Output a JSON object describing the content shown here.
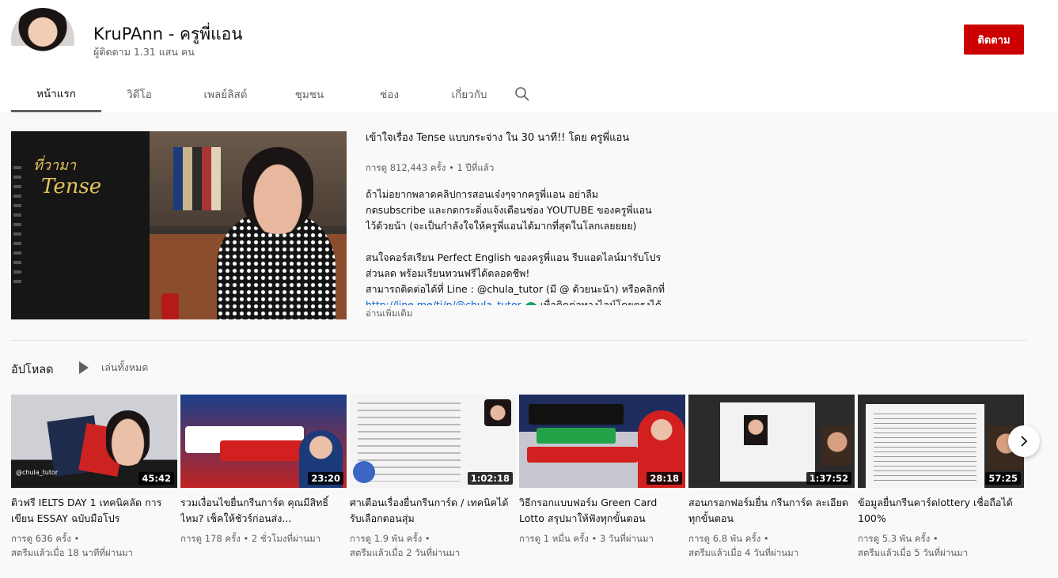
{
  "channel": {
    "title": "KruPAnn - ครูพี่แอน",
    "subscribers": "ผู้ติดตาม 1.31 แสน คน",
    "subscribe_label": "ติดตาม"
  },
  "tabs": [
    {
      "label": "หน้าแรก",
      "active": true
    },
    {
      "label": "วิดีโอ"
    },
    {
      "label": "เพลย์ลิสต์"
    },
    {
      "label": "ชุมชน"
    },
    {
      "label": "ช่อง"
    },
    {
      "label": "เกี่ยวกับ"
    }
  ],
  "featured": {
    "title": "เข้าใจเรื่อง Tense แบบกระจ่าง ใน 30 นาที!! โดย ครูพี่แอน",
    "meta": "การดู 812,443 ครั้ง • 1 ปีที่แล้ว",
    "board_text_1": "ที่วามา",
    "board_text_2": "Tense",
    "description": [
      "ถ้าไม่อยากพลาดคลิปการสอนเจ๋งๆจากครูพี่แอน อย่าลืม",
      "กดsubscribe และกดกระดิ่งแจ้งเตือนช่อง YOUTUBE ของครูพี่แอน",
      "ไว้ด้วยน้า (จะเป็นกำลังใจให้ครูพี่แอนได้มากที่สุดในโลกเลยยยย)",
      "",
      "สนใจคอร์สเรียน Perfect English ของครูพี่แอน รีบแอดไลน์มารับโปร",
      "ส่วนลด พร้อมเรียนทวนฟรีได้ตลอดชีพ!",
      "สามารถติดต่อได้ที่ Line : @chula_tutor (มี @ ด้วยนะน้า)  หรือคลิกที่"
    ],
    "link": "http://line.me/ti/p/@chula_tutor",
    "link_suffix": "เพื่อติดต่อทางไลน์โดยตรงได้",
    "read_more": "อ่านเพิ่มเติม"
  },
  "uploads": {
    "title": "อัปโหลด",
    "play_all": "เล่นทั้งหมด",
    "videos": [
      {
        "title": "ติวฟรี IELTS DAY 1 เทคนิคลัด การเขียน ESSAY ฉบับมือโปร",
        "duration": "45:42",
        "views": "การดู 636 ครั้ง •",
        "time": "สตรีมแล้วเมื่อ 18 นาทีที่ผ่านมา",
        "thumb_caption": "@chula_tutor"
      },
      {
        "title": "รวมเงื่อนไขยื่นกรีนการ์ด คุณมีสิทธิ์ไหม? เช็คให้ชัวร์ก่อนส่ง...",
        "duration": "23:20",
        "views": "การดู 178 ครั้ง • 2 ชั่วโมงที่ผ่านมา",
        "time": ""
      },
      {
        "title": "ศาเตือนเรื่องยื่นกรีนการ์ด / เทคนิคได้รับเลือกตอนสุ่ม",
        "duration": "1:02:18",
        "views": "การดู 1.9 พัน ครั้ง •",
        "time": "สตรีมแล้วเมื่อ 2 วันที่ผ่านมา"
      },
      {
        "title": "วิธีกรอกแบบฟอร์ม Green Card Lotto สรุปมาให้ฟังทุกขั้นตอน",
        "duration": "28:18",
        "views": "การดู 1 หมื่น ครั้ง • 3 วันที่ผ่านมา",
        "time": ""
      },
      {
        "title": "สอนกรอกฟอร์มยื่น กรีนการ์ด ละเอียดทุกขั้นตอน",
        "duration": "1:37:52",
        "views": "การดู 6.8 พัน ครั้ง •",
        "time": "สตรีมแล้วเมื่อ 4 วันที่ผ่านมา"
      },
      {
        "title": "ข้อมูลยื่นกรีนคาร์ดlottery เชื่อถือได้ 100%",
        "duration": "57:25",
        "views": "การดู 5.3 พัน ครั้ง •",
        "time": "สตรีมแล้วเมื่อ 5 วันที่ผ่านมา"
      }
    ]
  },
  "colors": {
    "subscribe": "#cc0000",
    "link": "#065fd4",
    "meta": "#606060"
  },
  "icons": [
    "search-icon",
    "play-all-icon",
    "chevron-right-icon",
    "verified-check-icon"
  ]
}
